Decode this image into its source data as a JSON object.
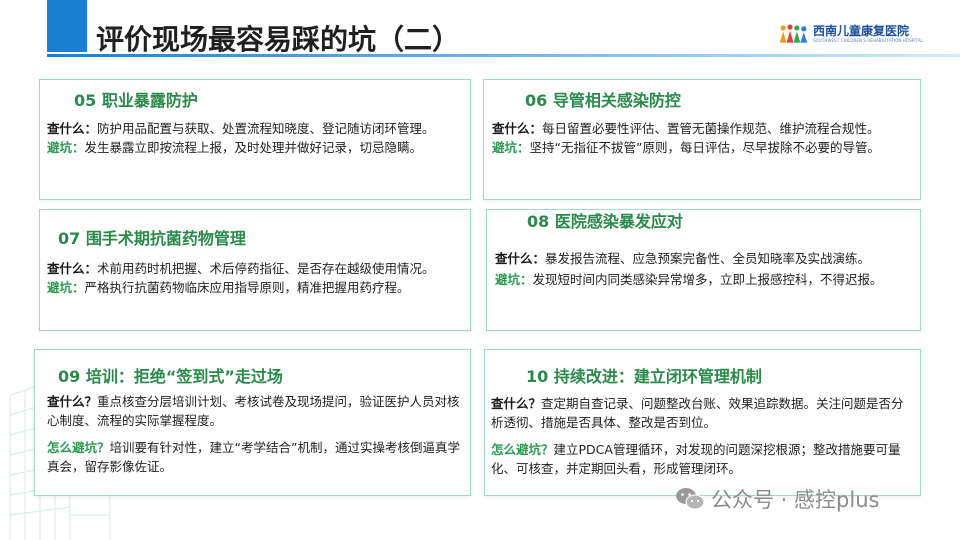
{
  "header": {
    "title": "评价现场最容易踩的坑（二）",
    "logo_name": "西南儿童康复医院",
    "logo_subtitle": "SOUTHWEST CHILDREN'S REHABILITATION HOSPITAL"
  },
  "colors": {
    "accent_blue": "#1a7fd0",
    "card_title_green": "#2a8a4a",
    "avoid_green": "#2a9a50",
    "card_border": "#9fd9c8"
  },
  "cards": [
    {
      "title": "05 职业暴露防护",
      "check_label": "查什么：",
      "check_text": "防护用品配置与获取、处置流程知晓度、登记随访闭环管理。",
      "avoid_label": "避坑：",
      "avoid_text": "发生暴露立即按流程上报，及时处理并做好记录，切忌隐瞒。"
    },
    {
      "title": "06 导管相关感染防控",
      "check_label": "查什么：",
      "check_text": "每日留置必要性评估、置管无菌操作规范、维护流程合规性。",
      "avoid_label": "避坑：",
      "avoid_text": "坚持“无指征不拔管”原则，每日评估，尽早拔除不必要的导管。"
    },
    {
      "title": "07 围手术期抗菌药物管理",
      "check_label": "查什么：",
      "check_text": "术前用药时机把握、术后停药指征、是否存在越级使用情况。",
      "avoid_label": "避坑：",
      "avoid_text": "严格执行抗菌药物临床应用指导原则，精准把握用药疗程。"
    },
    {
      "title": "08 医院感染暴发应对",
      "check_label": "查什么：",
      "check_text": "暴发报告流程、应急预案完备性、全员知晓率及实战演练。",
      "avoid_label": "避坑：",
      "avoid_text": "发现短时间内同类感染异常增多，立即上报感控科，不得迟报。"
    },
    {
      "title": "09 培训：拒绝“签到式”走过场",
      "check_label": "查什么？",
      "check_text": "重点核查分层培训计划、考核试卷及现场提问，验证医护人员对核心制度、流程的实际掌握程度。",
      "avoid_label": "怎么避坑？",
      "avoid_text": "培训要有针对性，建立“考学结合”机制，通过实操考核倒逼真学真会，留存影像佐证。"
    },
    {
      "title": "10 持续改进：建立闭环管理机制",
      "check_label": "查什么？",
      "check_text": "查定期自查记录、问题整改台账、效果追踪数据。关注问题是否分析透彻、措施是否具体、整改是否到位。",
      "avoid_label": "怎么避坑？",
      "avoid_text": "建立PDCA管理循环，对发现的问题深挖根源；整改措施要可量化、可核查，并定期回头看，形成管理闭环。"
    }
  ],
  "watermark": {
    "text": "公众号 · 感控plus",
    "icon": "wechat-icon"
  }
}
